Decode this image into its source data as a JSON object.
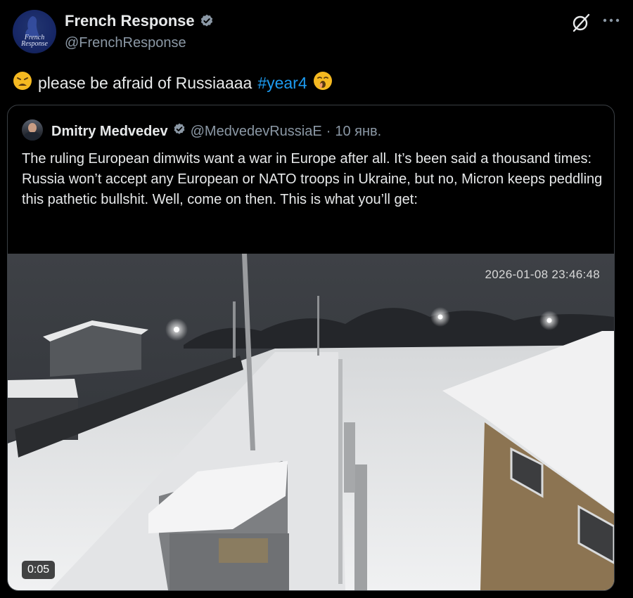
{
  "post": {
    "author": {
      "display_name": "French Response",
      "handle": "@FrenchResponse",
      "avatar_logo": "French Response",
      "verified_icon": "verified-badge-icon"
    },
    "header_icons": [
      "grok-icon",
      "more-icon"
    ],
    "text": {
      "leading_emoji": "weary-face-emoji",
      "body": "please be afraid of Russiaaaa",
      "hashtag": "#year4",
      "trailing_emoji": "yawning-face-emoji"
    }
  },
  "quoted": {
    "display_name": "Dmitry Medvedev",
    "handle": "@MedvedevRussiaE",
    "separator": "·",
    "date": "10 янв.",
    "text": "The ruling European dimwits want a war in Europe after all. It’s been said a thousand times: Russia won’t accept any European or NATO troops in Ukraine, but no, Micron keeps peddling this pathetic bullshit. Well, come on then. This is what you’ll get:",
    "video": {
      "timestamp": "2026-01-08 23:46:48",
      "duration": "0:05"
    }
  },
  "colors": {
    "background": "#000000",
    "text": "#e7e9ea",
    "secondary_text": "#8b98a5",
    "link": "#1d9bf0",
    "verified": "#8b98a5"
  }
}
